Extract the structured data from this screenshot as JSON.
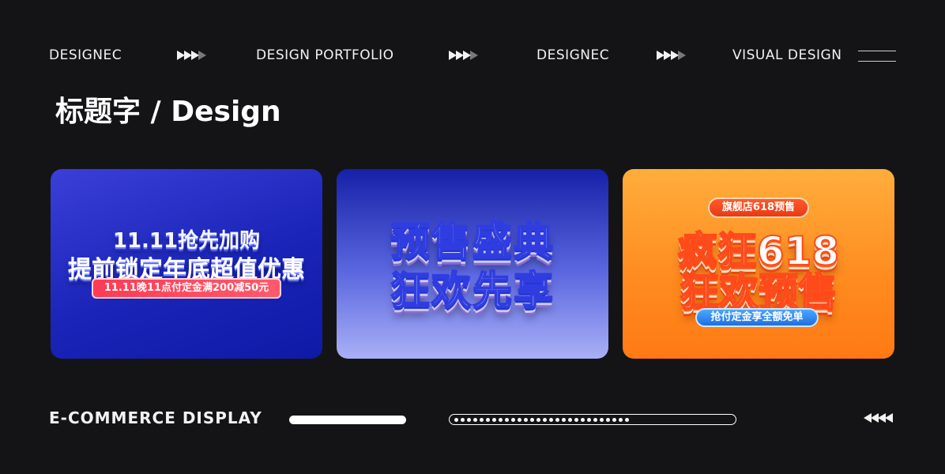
{
  "top_nav": {
    "items": [
      "DESIGNEC",
      "DESIGN PORTFOLIO",
      "DESIGNEC",
      "VISUAL DESIGN"
    ],
    "arrow_icon": "triple-arrow-right-icon",
    "menu_icon": "double-line-icon"
  },
  "heading": {
    "title": "标题字 / Design"
  },
  "cards": [
    {
      "line1": "11.11抢先加购",
      "line2": "提前锁定年底超值优惠",
      "tag": "11.11晚11点付定金满200减50元"
    },
    {
      "line1": "预售盛典",
      "line2": "狂欢先享"
    },
    {
      "pill": "旗舰店618预售",
      "line1": "疯狂618",
      "line2": "狂欢预售",
      "bar": "抢付定金享全额免单"
    }
  ],
  "footer": {
    "label": "E-COMMERCE DISPLAY",
    "arrow_icon": "triple-arrow-left-icon"
  },
  "colors": {
    "background": "#141416",
    "card1": "#1a24b8",
    "card2": "#5c68e0",
    "card3": "#ff8a1e"
  }
}
